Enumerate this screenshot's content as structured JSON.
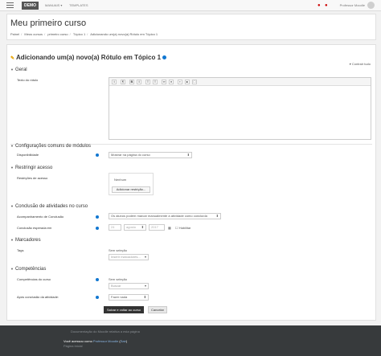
{
  "navbar": {
    "brand": "DEMO",
    "links": [
      "MANUAIS ▾",
      "TEMPLATES"
    ],
    "user_name": "Professor Moodle"
  },
  "header": {
    "title": "Meu primeiro curso",
    "breadcrumb": [
      "Painel",
      "Meus cursos",
      "primeiro curso",
      "Tópico 1",
      "Adicionando um(a) novo(a) Rótulo em Tópico 1"
    ]
  },
  "form": {
    "title": "Adicionando um(a) novo(a) Rótulo em Tópico 1",
    "collapse_all": "Contrair tudo",
    "sections": {
      "geral": "Geral",
      "config": "Configurações comuns de módulos",
      "restringir": "Restringir acesso",
      "conclusao": "Conclusão de atividades no curso",
      "marcadores": "Marcadores",
      "competencias": "Competências"
    },
    "fields": {
      "texto_rotulo": "Texto do rótulo",
      "disponibilidade": "Disponibilidade",
      "disponibilidade_value": "Mostrar na página do curso",
      "restricoes": "Restrições de acesso",
      "nenhum": "Nenhum",
      "adicionar_restricao": "Adicionar restrição...",
      "acompanhamento": "Acompanhamento de Conclusão",
      "acompanhamento_value": "Os alunos podem marcar manualmente a atividade como concluída",
      "conclusao_esperada": "Conclusão esperada em",
      "date_day": "24",
      "date_month": "agosto",
      "date_year": "2017",
      "habilitar": "Habilitar",
      "tags": "Tags",
      "sem_selecao": "Sem seleção",
      "inserir_marcadores": "Inserir marcadores...",
      "competencias_curso": "Competências do curso",
      "sem_selecao2": "Sem seleção",
      "buscar": "Buscar",
      "apos_conclusao": "Após conclusão da atividade:",
      "fazer_nada": "Fazer nada"
    },
    "buttons": {
      "save_return": "Salvar e voltar ao curso",
      "cancel": "Cancelar"
    }
  },
  "footer": {
    "line1": "Documentação do Moodle relativa a esta página",
    "line2_prefix": "Você acessou como ",
    "line2_user": "Professor Moodle",
    "line2_logout": "Sair",
    "line3": "Página inicial"
  }
}
